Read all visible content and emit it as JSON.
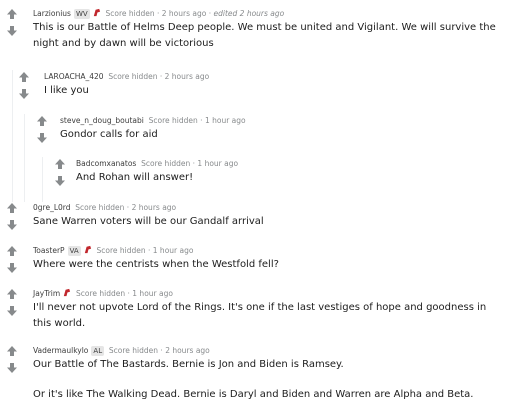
{
  "comments": [
    {
      "author": "Larzionius",
      "flair": "WV",
      "has_flair_icon": true,
      "score": "Score hidden",
      "time": "2 hours ago",
      "edited": "edited 2 hours ago",
      "body": [
        "This is our Battle of Helms Deep people. We must be united and Vigilant. We will survive the night and by dawn will be victorious"
      ]
    },
    {
      "author": "LAROACHA_420",
      "score": "Score hidden",
      "time": "2 hours ago",
      "body": [
        "I like you"
      ]
    },
    {
      "author": "steve_n_doug_boutabi",
      "score": "Score hidden",
      "time": "1 hour ago",
      "body": [
        "Gondor calls for aid"
      ]
    },
    {
      "author": "Badcomxanatos",
      "score": "Score hidden",
      "time": "1 hour ago",
      "body": [
        "And Rohan will answer!"
      ]
    },
    {
      "author": "0gre_L0rd",
      "score": "Score hidden",
      "time": "2 hours ago",
      "body": [
        "Sane Warren voters will be our Gandalf arrival"
      ]
    },
    {
      "author": "ToasterP",
      "flair": "VA",
      "has_flair_icon": true,
      "score": "Score hidden",
      "time": "1 hour ago",
      "body": [
        "Where were the centrists when the Westfold fell?"
      ]
    },
    {
      "author": "JayTrim",
      "has_flair_icon": true,
      "score": "Score hidden",
      "time": "1 hour ago",
      "body": [
        "I'll never not upvote Lord of the Rings. It's one if the last vestiges of hope and goodness in this world."
      ]
    },
    {
      "author": "Vadermaulkylo",
      "flair": "AL",
      "score": "Score hidden",
      "time": "2 hours ago",
      "body": [
        "Our Battle of The Bastards. Bernie is Jon and Biden is Ramsey.",
        "Or it's like The Walking Dead. Bernie is Daryl and Biden and Warren are Alpha and Beta."
      ]
    }
  ],
  "separator": "·",
  "icons": {
    "upvote": "upvote-arrow-icon",
    "downvote": "downvote-arrow-icon",
    "flair": "flair-emoji-icon"
  },
  "colors": {
    "meta": "#878a8c",
    "thread_line": "#edeff1",
    "vote": "#878a8c"
  }
}
